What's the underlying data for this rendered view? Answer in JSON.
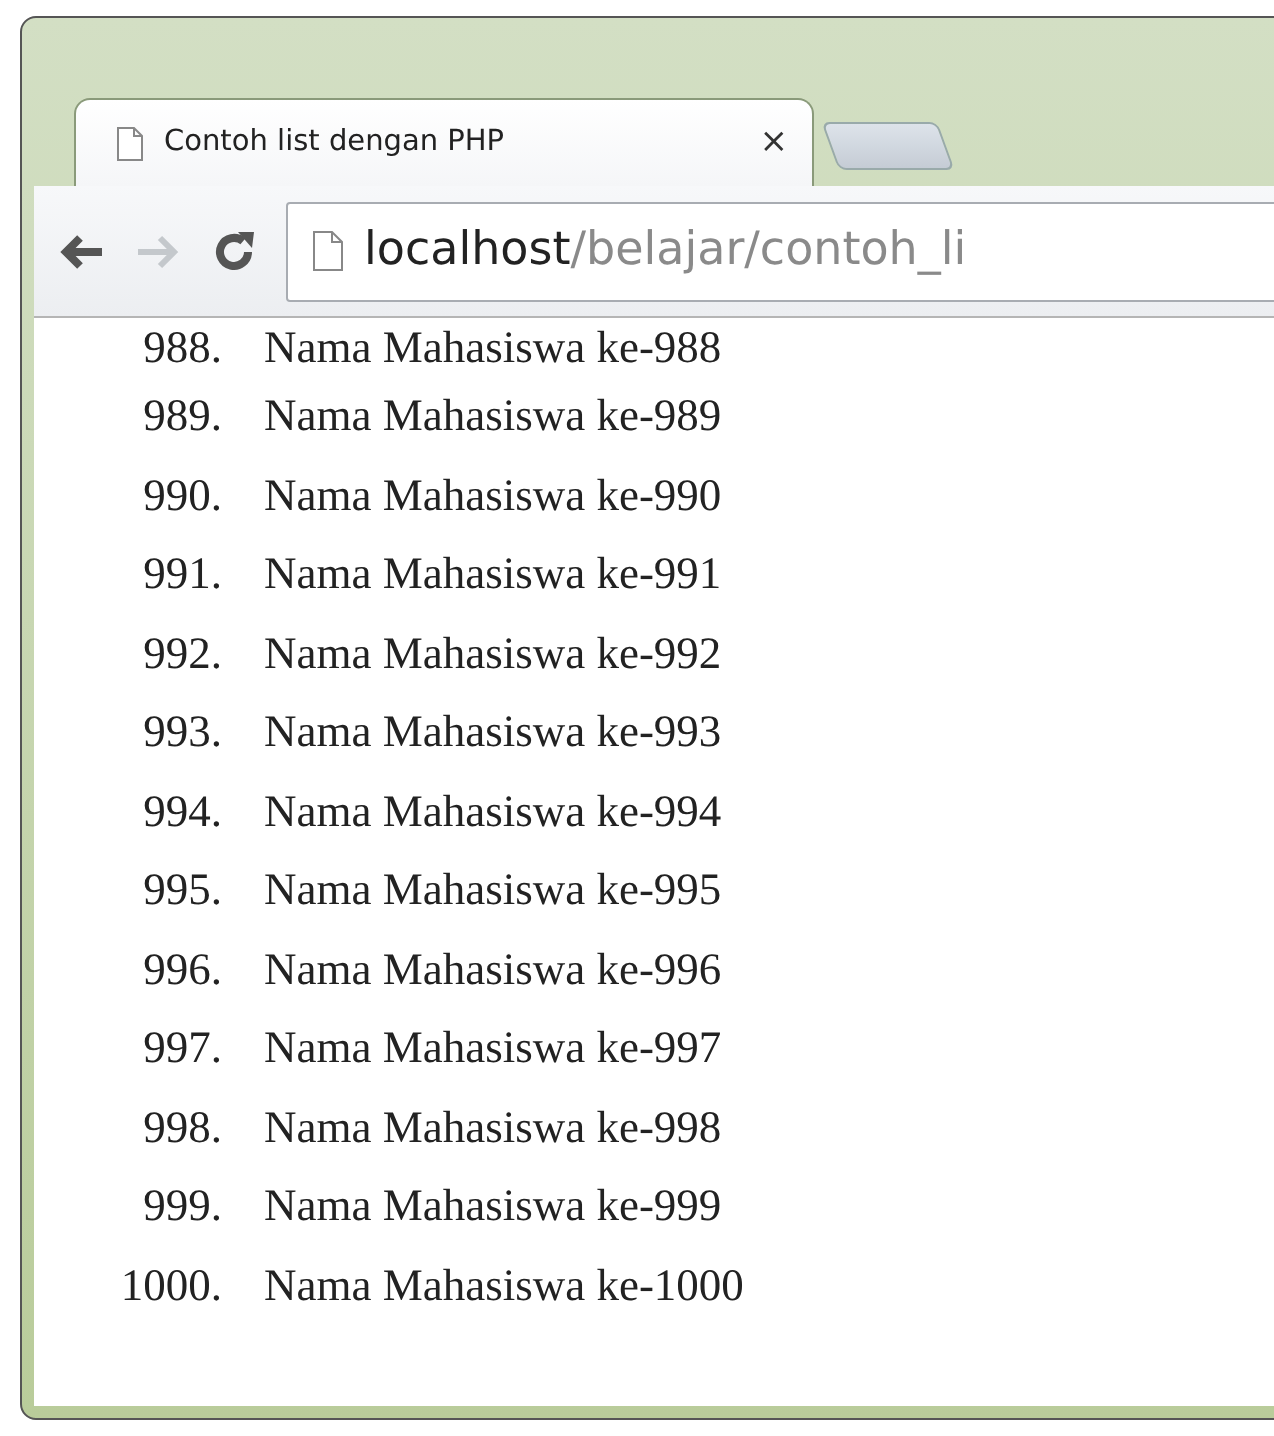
{
  "tab": {
    "title": "Contoh list dengan PHP",
    "close": "×"
  },
  "toolbar": {
    "back_enabled": true,
    "forward_enabled": false
  },
  "address": {
    "host": "localhost",
    "path": "/belajar/contoh_li"
  },
  "list": [
    {
      "number": "988.",
      "text": "Nama Mahasiswa ke-988"
    },
    {
      "number": "989.",
      "text": "Nama Mahasiswa ke-989"
    },
    {
      "number": "990.",
      "text": "Nama Mahasiswa ke-990"
    },
    {
      "number": "991.",
      "text": "Nama Mahasiswa ke-991"
    },
    {
      "number": "992.",
      "text": "Nama Mahasiswa ke-992"
    },
    {
      "number": "993.",
      "text": "Nama Mahasiswa ke-993"
    },
    {
      "number": "994.",
      "text": "Nama Mahasiswa ke-994"
    },
    {
      "number": "995.",
      "text": "Nama Mahasiswa ke-995"
    },
    {
      "number": "996.",
      "text": "Nama Mahasiswa ke-996"
    },
    {
      "number": "997.",
      "text": "Nama Mahasiswa ke-997"
    },
    {
      "number": "998.",
      "text": "Nama Mahasiswa ke-998"
    },
    {
      "number": "999.",
      "text": "Nama Mahasiswa ke-999"
    },
    {
      "number": "1000.",
      "text": "Nama Mahasiswa ke-1000"
    }
  ]
}
